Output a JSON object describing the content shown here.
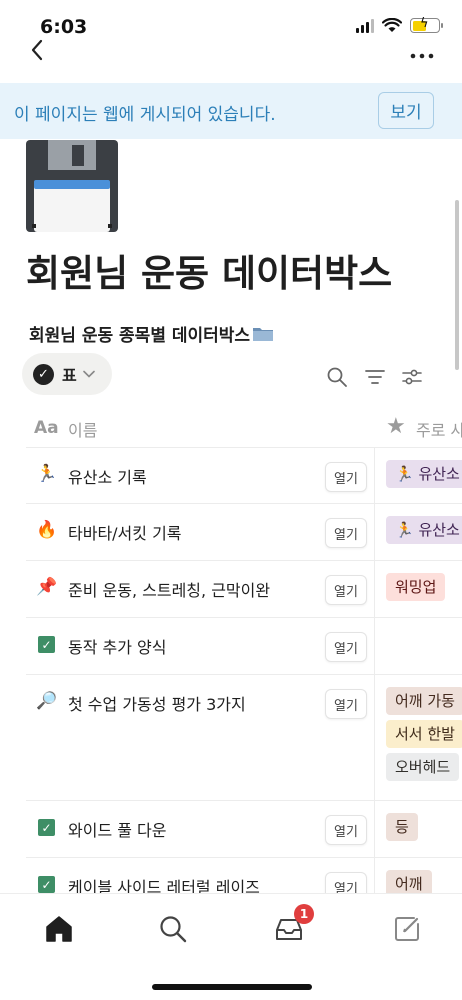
{
  "status_bar": {
    "time": "6:03"
  },
  "banner": {
    "text": "이 페이지는 웹에 게시되어 있습니다.",
    "button_label": "보기"
  },
  "page": {
    "title": "회원님 운동 데이터박스",
    "icon": "floppy-disk-icon",
    "database_title": "회원님 운동 종목별 데이터박스"
  },
  "view": {
    "label": "표"
  },
  "table": {
    "headers": {
      "title_icon": "Aa",
      "name": "이름",
      "main": "주로 사"
    },
    "open_label": "열기",
    "rows": [
      {
        "icon": "runner",
        "name": "유산소 기록",
        "tags": [
          {
            "label": "🏃 유산소",
            "color": "purple"
          }
        ]
      },
      {
        "icon": "fire",
        "name": "타바타/서킷 기록",
        "tags": [
          {
            "label": "🏃 유산소",
            "color": "purple"
          }
        ]
      },
      {
        "icon": "pushpin",
        "name": "준비 운동,  스트레칭, 근막이완",
        "tags": [
          {
            "label": "워밍업",
            "color": "red"
          }
        ]
      },
      {
        "icon": "checkbox",
        "name": "동작 추가 양식",
        "tags": []
      },
      {
        "icon": "magnifier",
        "name": "첫 수업 가동성 평가 3가지",
        "tags": [
          {
            "label": "어깨 가동",
            "color": "brown"
          },
          {
            "label": "서서 한발",
            "color": "yellow"
          },
          {
            "label": "오버헤드",
            "color": "gray"
          }
        ]
      },
      {
        "icon": "checkbox",
        "name": "와이드 풀 다운",
        "tags": [
          {
            "label": "등",
            "color": "brown"
          }
        ]
      },
      {
        "icon": "checkbox",
        "name": "케이블 사이드 레터럴 레이즈",
        "tags": [
          {
            "label": "어깨",
            "color": "brown"
          }
        ]
      }
    ]
  },
  "tab_bar": {
    "inbox_badge": "1"
  }
}
